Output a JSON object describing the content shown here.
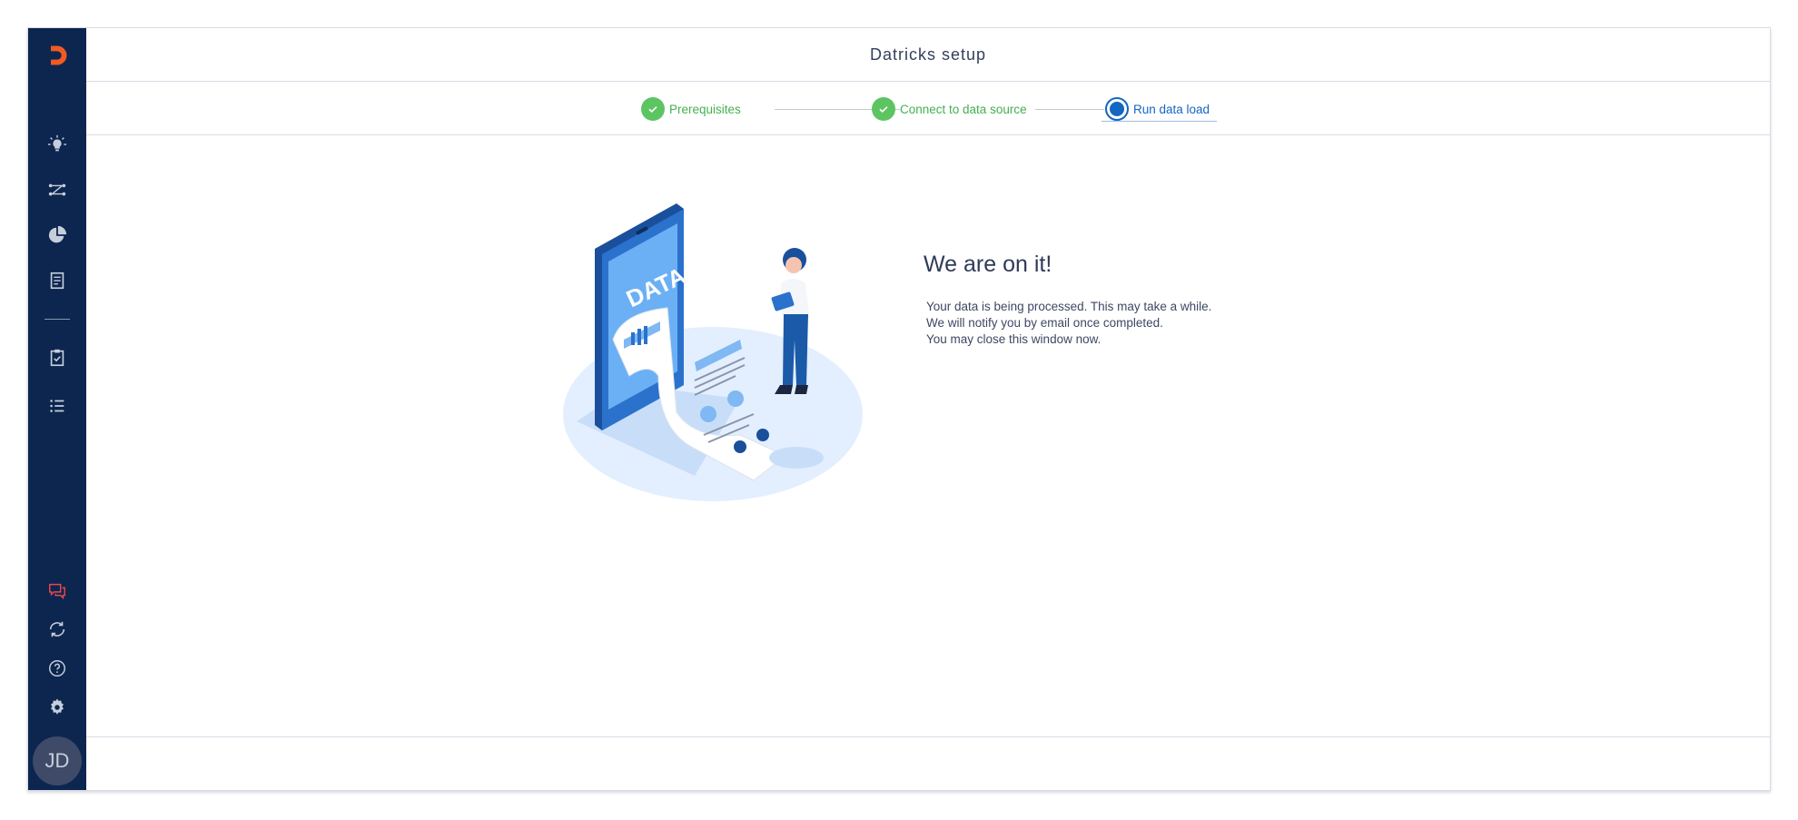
{
  "app": {
    "logo": "datricks-d-logo",
    "brand_color": "#f15a22",
    "sidebar_color": "#0c2650",
    "accent_color": "#1466c0",
    "success_color": "#5cc562"
  },
  "header": {
    "title": "Datricks setup"
  },
  "sidebar": {
    "top_items": [
      {
        "icon": "lightbulb-icon"
      },
      {
        "icon": "flow-icon"
      },
      {
        "icon": "pie-chart-icon"
      },
      {
        "icon": "document-icon"
      },
      {
        "icon": "clipboard-check-icon"
      },
      {
        "icon": "list-icon"
      }
    ],
    "bottom_items": [
      {
        "icon": "chat-icon"
      },
      {
        "icon": "refresh-icon"
      },
      {
        "icon": "help-icon"
      },
      {
        "icon": "gear-icon"
      }
    ],
    "avatar_initials": "JD"
  },
  "stepper": {
    "steps": [
      {
        "label": "Prerequisites",
        "state": "completed"
      },
      {
        "label": "Connect to data source",
        "state": "completed"
      },
      {
        "label": "Run data load",
        "state": "active"
      }
    ]
  },
  "message": {
    "title": "We are on it!",
    "lines": [
      "Your data is being processed. This may take a while.",
      "We will notify you by email once completed.",
      "You may close this window now."
    ]
  },
  "illustration": {
    "screen_text": "DATA"
  }
}
